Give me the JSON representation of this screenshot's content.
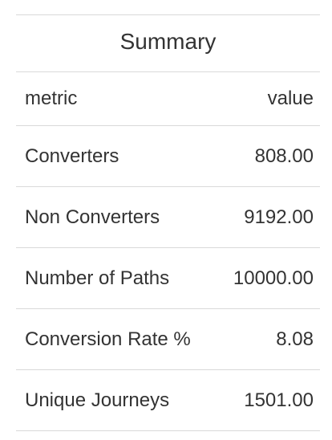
{
  "table": {
    "title": "Summary",
    "columns": {
      "metric": "metric",
      "value": "value"
    },
    "rows": [
      {
        "metric": "Converters",
        "value": "808.00"
      },
      {
        "metric": "Non Converters",
        "value": "9192.00"
      },
      {
        "metric": "Number of Paths",
        "value": "10000.00"
      },
      {
        "metric": "Conversion Rate %",
        "value": "8.08"
      },
      {
        "metric": "Unique Journeys",
        "value": "1501.00"
      }
    ]
  }
}
